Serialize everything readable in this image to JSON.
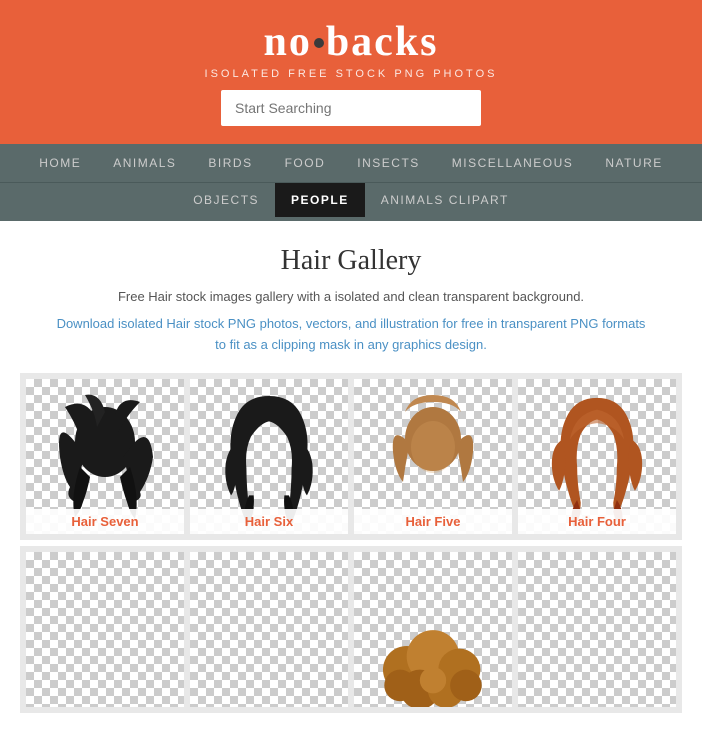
{
  "header": {
    "logo_text": "nobacks",
    "tagline": "Isolated Free Stock PNG Photos",
    "search_placeholder": "Start Searching"
  },
  "nav_primary": {
    "items": [
      {
        "label": "HOME",
        "href": "#"
      },
      {
        "label": "ANIMALS",
        "href": "#"
      },
      {
        "label": "BIRDS",
        "href": "#"
      },
      {
        "label": "FOOD",
        "href": "#"
      },
      {
        "label": "INSECTS",
        "href": "#"
      },
      {
        "label": "MISCELLANEOUS",
        "href": "#"
      },
      {
        "label": "NATURE",
        "href": "#"
      }
    ]
  },
  "nav_secondary": {
    "items": [
      {
        "label": "OBJECTS",
        "href": "#",
        "active": false
      },
      {
        "label": "PEOPLE",
        "href": "#",
        "active": true
      },
      {
        "label": "ANIMALS CLIPART",
        "href": "#",
        "active": false
      }
    ]
  },
  "gallery": {
    "title": "Hair Gallery",
    "desc": "Free Hair stock images gallery with a isolated and clean transparent background.",
    "desc_link": "Download isolated Hair stock PNG photos, vectors, and illustration for free in transparent PNG formats to fit as a clipping mask in any graphics design.",
    "items": [
      {
        "id": "hair-seven",
        "label": "Hair Seven"
      },
      {
        "id": "hair-six",
        "label": "Hair Six"
      },
      {
        "id": "hair-five",
        "label": "Hair Five"
      },
      {
        "id": "hair-four",
        "label": "Hair Four"
      },
      {
        "id": "hair-extra",
        "label": ""
      }
    ]
  },
  "colors": {
    "header_bg": "#e8603a",
    "nav_bg": "#5a6a6a",
    "accent": "#e8603a",
    "link_color": "#4a90c4"
  }
}
